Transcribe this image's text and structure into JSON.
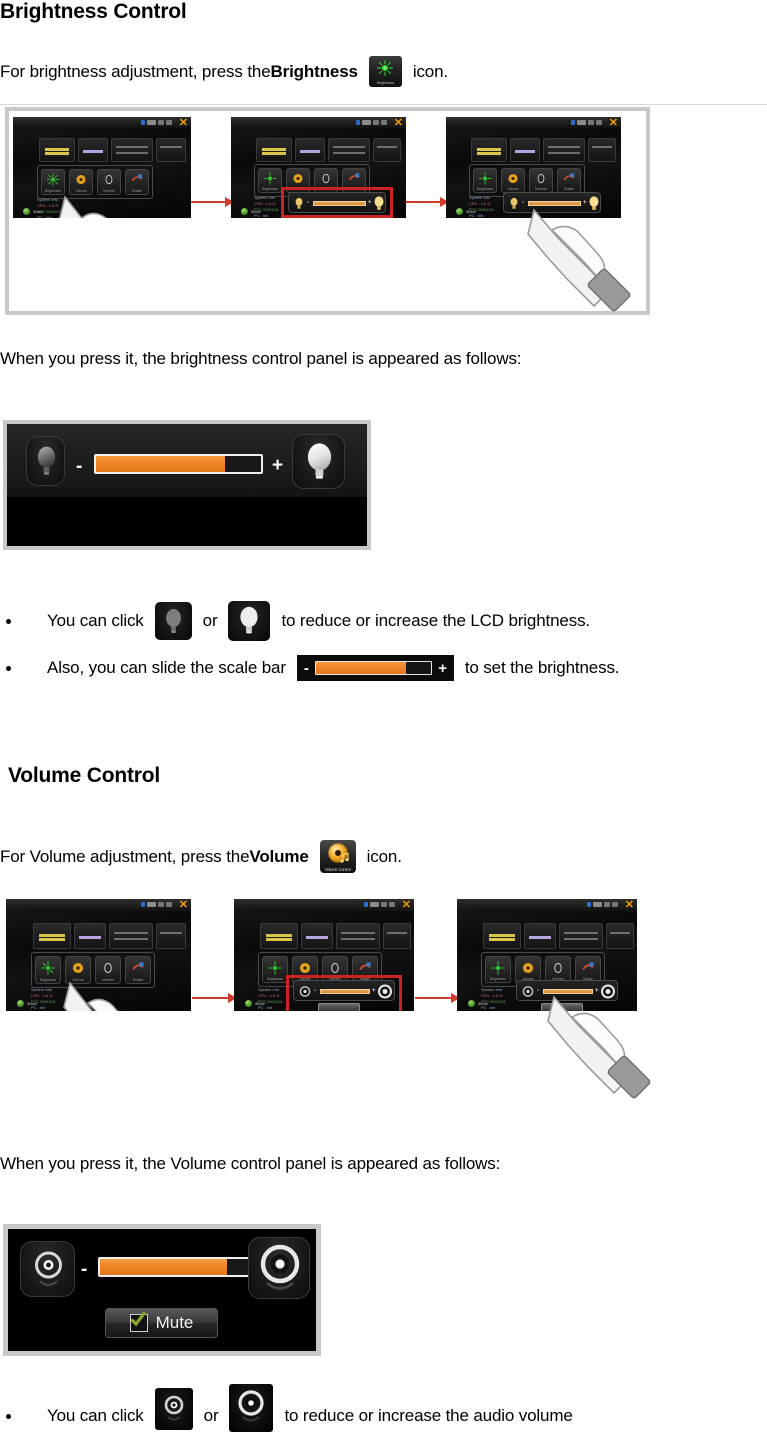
{
  "document": {
    "sections": [
      {
        "id": "brightness",
        "heading": "Brightness Control",
        "intro_before": "For brightness adjustment, press the ",
        "intro_bold": "Brightness",
        "intro_after": "icon.",
        "icon_name": "brightness-launcher-icon",
        "icon_caption": "Brightness",
        "panel_caption": "When you press it, the brightness control panel is appeared as follows:",
        "bullets": [
          {
            "before": "You can click",
            "middle": "or",
            "after": "to reduce or increase the LCD brightness."
          },
          {
            "before": "Also, you can slide the scale bar",
            "after": "to set the brightness."
          }
        ],
        "panel": {
          "minus_label": "-",
          "plus_label": "+",
          "slider_percent": 78,
          "left_button_name": "decrease-brightness-button",
          "right_button_name": "increase-brightness-button"
        }
      },
      {
        "id": "volume",
        "heading": "Volume Control",
        "intro_before": "For Volume adjustment, press the ",
        "intro_bold": "Volume",
        "intro_after": "icon.",
        "icon_name": "volume-launcher-icon",
        "icon_caption": "Volume Control",
        "panel_caption": "When you press it, the Volume control panel is appeared as follows:",
        "bullets": [
          {
            "before": "You can click",
            "middle": "or",
            "after": "to reduce or increase the audio volume"
          }
        ],
        "panel": {
          "minus_label": "-",
          "plus_label": "+",
          "slider_percent": 79,
          "mute_label": "Mute",
          "left_button_name": "decrease-volume-button",
          "right_button_name": "increase-volume-button"
        }
      }
    ]
  },
  "colors": {
    "slider_fill": "#ee8024",
    "panel_background": "#000000",
    "panel_frame": "#c8c8c8",
    "highlight_box": "#cc2222",
    "arrow": "#d23b2b",
    "brightness_glyph": "#3ecc3e",
    "volume_glyph": "#f2a820"
  },
  "screenshot_sequences": {
    "brightness": {
      "steps": [
        {
          "label": "tap-brightness-icon"
        },
        {
          "label": "brightness-panel-highlighted"
        },
        {
          "label": "drag-brightness-slider"
        }
      ]
    },
    "volume": {
      "steps": [
        {
          "label": "tap-volume-icon"
        },
        {
          "label": "volume-panel-highlighted"
        },
        {
          "label": "drag-volume-slider"
        }
      ]
    }
  },
  "device_ui": {
    "tiles": [
      "Brightness",
      "Volume Control",
      "Internet",
      "Screen Rotate"
    ],
    "info_lines": [
      "System Info",
      "CPU",
      "RTC",
      "PC"
    ],
    "brand": "iBase"
  }
}
